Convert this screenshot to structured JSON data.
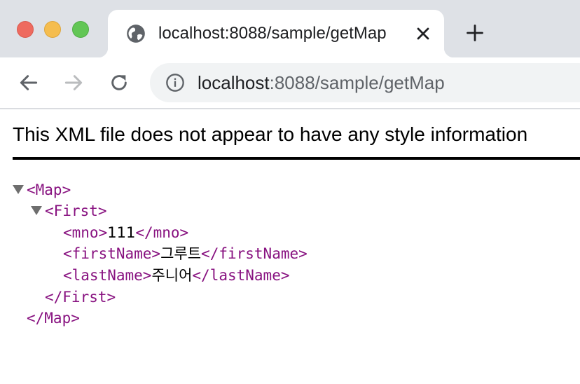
{
  "browser": {
    "tab": {
      "title": "localhost:8088/sample/getMap"
    },
    "toolbar": {
      "url_host": "localhost",
      "url_path": ":8088/sample/getMap"
    },
    "icons": [
      "globe-icon",
      "close-icon",
      "plus-icon",
      "back-arrow-icon",
      "forward-arrow-icon",
      "reload-icon",
      "info-icon"
    ]
  },
  "content": {
    "notice": "This XML file does not appear to have any style information",
    "xml": {
      "map_open": "<Map>",
      "first_open": "<First>",
      "mno_open": "<mno>",
      "mno_value": "111",
      "mno_close": "</mno>",
      "firstName_open": "<firstName>",
      "firstName_value": "그루트",
      "firstName_close": "</firstName>",
      "lastName_open": "<lastName>",
      "lastName_value": "주니어",
      "lastName_close": "</lastName>",
      "first_close": "</First>",
      "map_close": "</Map>"
    }
  },
  "colors": {
    "tabstrip_bg": "#dee1e6",
    "xml_tag": "#881280",
    "close_red": "#ee6a5f",
    "minimize_yellow": "#f5bd4f",
    "zoom_green": "#62c655"
  }
}
